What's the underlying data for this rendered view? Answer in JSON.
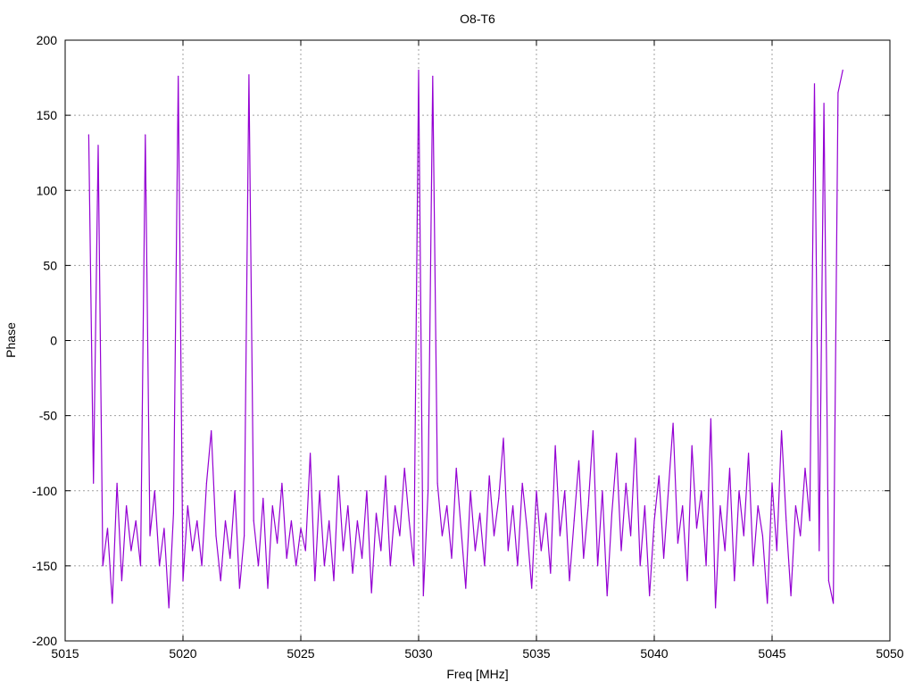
{
  "chart_data": {
    "type": "line",
    "title": "O8-T6",
    "xlabel": "Freq [MHz]",
    "ylabel": "Phase",
    "xlim": [
      5015,
      5050
    ],
    "ylim": [
      -200,
      200
    ],
    "xticks": [
      5015,
      5020,
      5025,
      5030,
      5035,
      5040,
      5045,
      5050
    ],
    "yticks": [
      -200,
      -150,
      -100,
      -50,
      0,
      50,
      100,
      150,
      200
    ],
    "grid": true,
    "legend": "none",
    "series": [
      {
        "name": "O8-T6",
        "color": "#9400d3",
        "x_start": 5016.0,
        "x_step": 0.2,
        "values": [
          137,
          -95,
          130,
          -150,
          -125,
          -175,
          -95,
          -160,
          -110,
          -140,
          -120,
          -150,
          137,
          -130,
          -100,
          -150,
          -125,
          -178,
          -115,
          176,
          -160,
          -110,
          -140,
          -120,
          -150,
          -95,
          -60,
          -130,
          -160,
          -120,
          -145,
          -100,
          -165,
          -130,
          177,
          -120,
          -150,
          -105,
          -165,
          -110,
          -135,
          -95,
          -145,
          -120,
          -150,
          -125,
          -140,
          -75,
          -160,
          -100,
          -150,
          -120,
          -160,
          -90,
          -140,
          -110,
          -155,
          -120,
          -145,
          -100,
          -168,
          -115,
          -140,
          -90,
          -150,
          -110,
          -130,
          -85,
          -120,
          -150,
          180,
          -170,
          -100,
          176,
          -95,
          -130,
          -110,
          -145,
          -85,
          -125,
          -165,
          -100,
          -140,
          -115,
          -150,
          -90,
          -130,
          -105,
          -65,
          -140,
          -110,
          -150,
          -95,
          -125,
          -165,
          -100,
          -140,
          -115,
          -155,
          -70,
          -130,
          -100,
          -160,
          -120,
          -80,
          -145,
          -110,
          -60,
          -150,
          -100,
          -170,
          -115,
          -75,
          -140,
          -95,
          -130,
          -65,
          -150,
          -110,
          -170,
          -120,
          -90,
          -145,
          -100,
          -55,
          -135,
          -110,
          -160,
          -70,
          -125,
          -100,
          -150,
          -52,
          -178,
          -110,
          -140,
          -85,
          -160,
          -100,
          -130,
          -75,
          -150,
          -110,
          -130,
          -175,
          -95,
          -140,
          -60,
          -120,
          -170,
          -110,
          -130,
          -85,
          -120,
          171,
          -140,
          158,
          -160,
          -175,
          165,
          180
        ]
      }
    ]
  }
}
